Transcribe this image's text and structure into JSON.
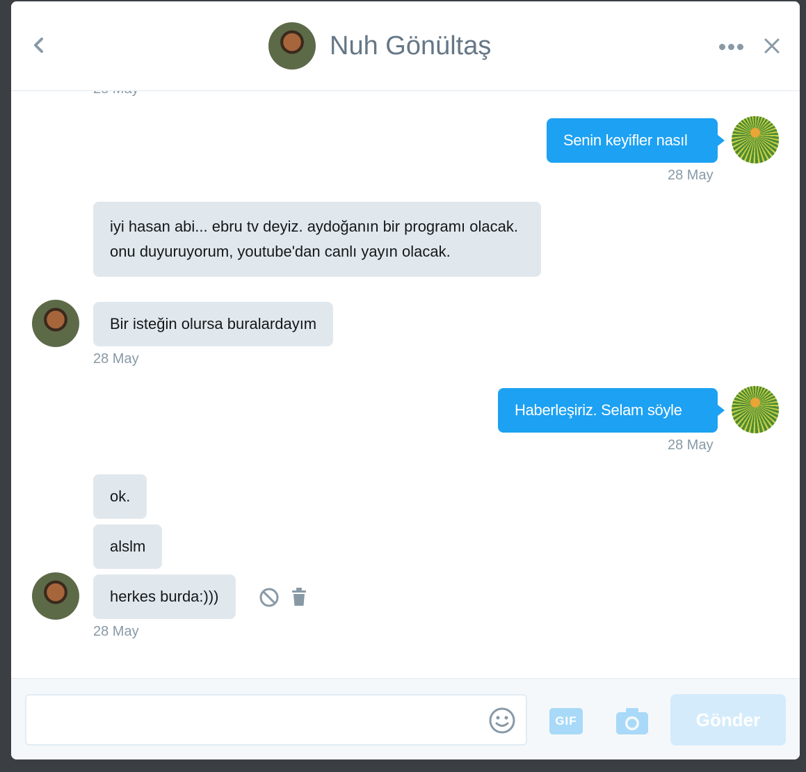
{
  "header": {
    "title": "Nuh Gönültaş",
    "back_icon": "chevron-left-icon",
    "more_icon": "more-dots-icon",
    "close_icon": "close-icon"
  },
  "thread": {
    "cut_off_date": "28 May",
    "messages": [
      {
        "direction": "out",
        "text": "Senin keyifler nasıl",
        "date": "28 May"
      },
      {
        "direction": "in",
        "text": "iyi hasan abi... ebru tv deyiz. aydoğanın bir programı olacak. onu duyuruyorum, youtube'dan canlı yayın olacak."
      },
      {
        "direction": "in",
        "text": "Bir isteğin olursa buralardayım",
        "date": "28 May"
      },
      {
        "direction": "out",
        "text": "Haberleşiriz. Selam söyle",
        "date": "28 May"
      },
      {
        "direction": "in",
        "text": "ok."
      },
      {
        "direction": "in",
        "text": "alslm"
      },
      {
        "direction": "in",
        "text": "herkes burda:)))",
        "date": "28 May"
      }
    ],
    "message_actions": [
      "block-icon",
      "trash-icon"
    ]
  },
  "composer": {
    "input_value": "",
    "emoji_icon": "emoji-icon",
    "gif_label": "GIF",
    "camera_icon": "camera-icon",
    "send_label": "Gönder"
  },
  "colors": {
    "outgoing_bubble": "#1da1f2",
    "incoming_bubble": "#e1e8ed",
    "send_disabled": "#d4ebfb",
    "meta_text": "#8899a6"
  }
}
